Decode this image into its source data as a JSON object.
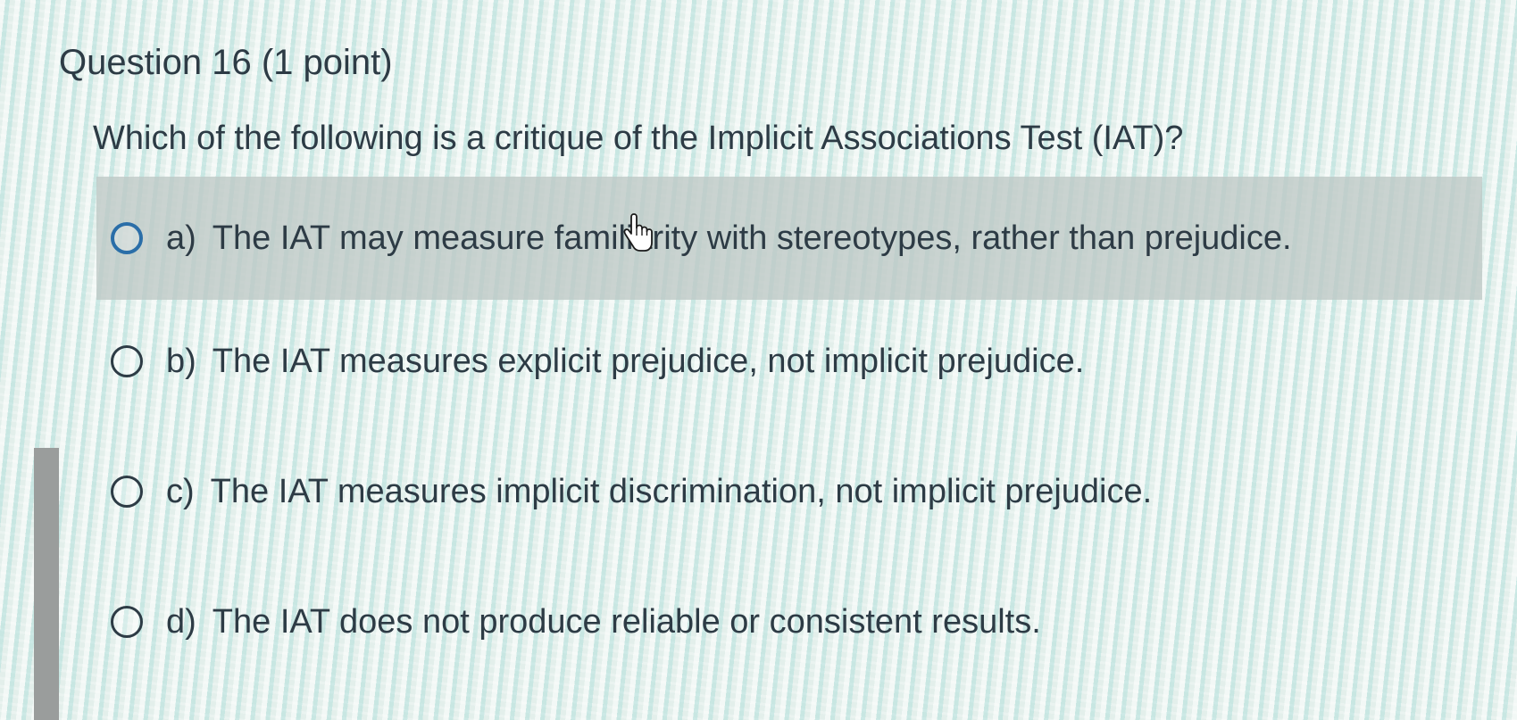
{
  "question": {
    "title": "Question 16 (1 point)",
    "prompt": "Which of the following is a critique of the Implicit Associations Test (IAT)?"
  },
  "choices": [
    {
      "letter": "a)",
      "text": "The IAT may measure familiarity with stereotypes, rather than prejudice.",
      "hovered": true
    },
    {
      "letter": "b)",
      "text": "The IAT measures explicit prejudice, not implicit prejudice.",
      "hovered": false
    },
    {
      "letter": "c)",
      "text": "The IAT measures implicit discrimination, not implicit prejudice.",
      "hovered": false
    },
    {
      "letter": "d)",
      "text": "The IAT does not produce reliable or consistent results.",
      "hovered": false
    }
  ],
  "cursor_icon": "hand-pointer-icon",
  "colors": {
    "text": "#2d3b45",
    "radio_hover": "#2a6ea8",
    "hover_row": "#bec8c5"
  }
}
